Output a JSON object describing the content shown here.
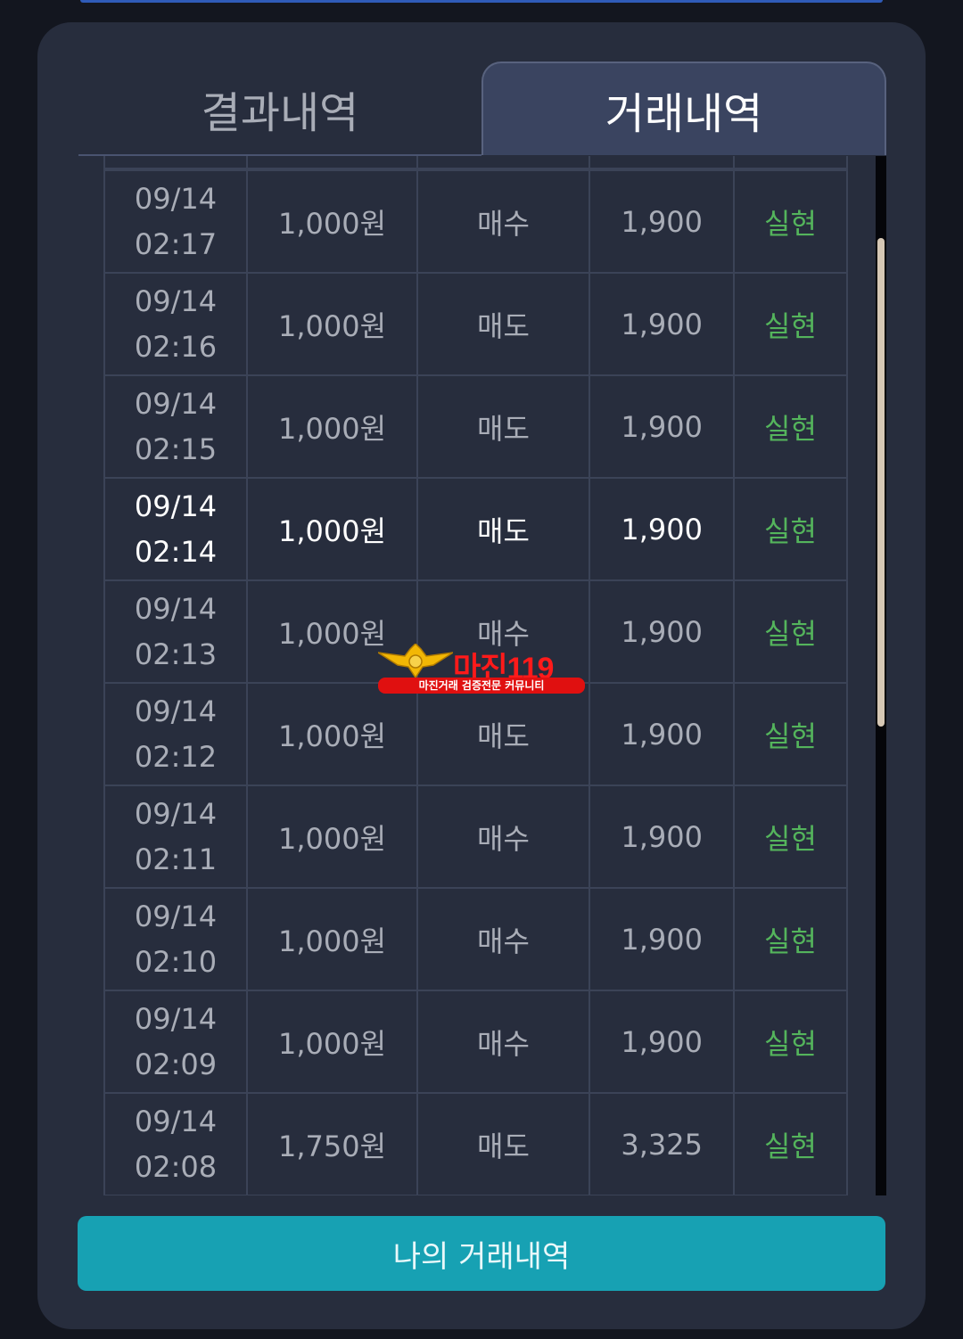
{
  "tabs": {
    "results_label": "결과내역",
    "trades_label": "거래내역"
  },
  "trades": [
    {
      "date": "09/14",
      "time": "02:17",
      "amount": "1,000원",
      "side": "매수",
      "payout": "1,900",
      "status": "실현"
    },
    {
      "date": "09/14",
      "time": "02:16",
      "amount": "1,000원",
      "side": "매도",
      "payout": "1,900",
      "status": "실현"
    },
    {
      "date": "09/14",
      "time": "02:15",
      "amount": "1,000원",
      "side": "매도",
      "payout": "1,900",
      "status": "실현"
    },
    {
      "date": "09/14",
      "time": "02:14",
      "amount": "1,000원",
      "side": "매도",
      "payout": "1,900",
      "status": "실현"
    },
    {
      "date": "09/14",
      "time": "02:13",
      "amount": "1,000원",
      "side": "매수",
      "payout": "1,900",
      "status": "실현"
    },
    {
      "date": "09/14",
      "time": "02:12",
      "amount": "1,000원",
      "side": "매도",
      "payout": "1,900",
      "status": "실현"
    },
    {
      "date": "09/14",
      "time": "02:11",
      "amount": "1,000원",
      "side": "매수",
      "payout": "1,900",
      "status": "실현"
    },
    {
      "date": "09/14",
      "time": "02:10",
      "amount": "1,000원",
      "side": "매수",
      "payout": "1,900",
      "status": "실현"
    },
    {
      "date": "09/14",
      "time": "02:09",
      "amount": "1,000원",
      "side": "매수",
      "payout": "1,900",
      "status": "실현"
    },
    {
      "date": "09/14",
      "time": "02:08",
      "amount": "1,750원",
      "side": "매도",
      "payout": "3,325",
      "status": "실현"
    }
  ],
  "watermark": {
    "title": "마진119",
    "subtitle": "마진거래 검증전문 커뮤니티"
  },
  "my_trades_button": "나의 거래내역",
  "colors": {
    "accent": "#17a1b3",
    "status_green": "#54b45c",
    "panel": "#272d3d",
    "active_tab": "#3a4460"
  }
}
